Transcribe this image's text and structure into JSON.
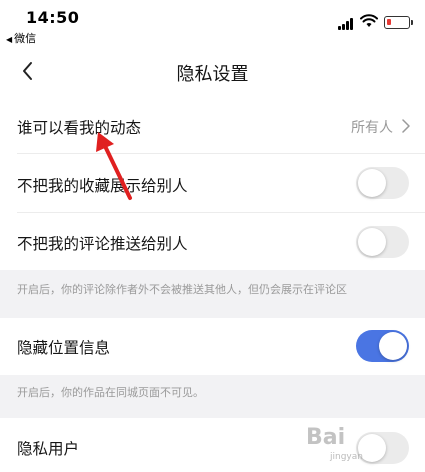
{
  "status_bar": {
    "time": "14:50",
    "back_app": "微信",
    "battery_color": "#e53935"
  },
  "nav": {
    "title": "隐私设置",
    "back_icon": "chevron-left-icon"
  },
  "settings": {
    "who_can_see": {
      "label": "谁可以看我的动态",
      "value": "所有人"
    },
    "hide_favorites": {
      "label": "不把我的收藏展示给别人",
      "enabled": false
    },
    "hide_comments": {
      "label": "不把我的评论推送给别人",
      "enabled": false
    },
    "comments_hint": "开启后，你的评论除作者外不会被推送其他人，但仍会展示在评论区",
    "hide_location": {
      "label": "隐藏位置信息",
      "enabled": true
    },
    "location_hint": "开启后，你的作品在同城页面不可见。",
    "private_user": {
      "label": "隐私用户",
      "enabled": false
    }
  },
  "colors": {
    "toggle_on": "#4a75e3",
    "toggle_off": "#ebebeb",
    "annotation_arrow": "#e02020"
  },
  "watermark": {
    "text": "Bai",
    "sub": "jingyan"
  }
}
